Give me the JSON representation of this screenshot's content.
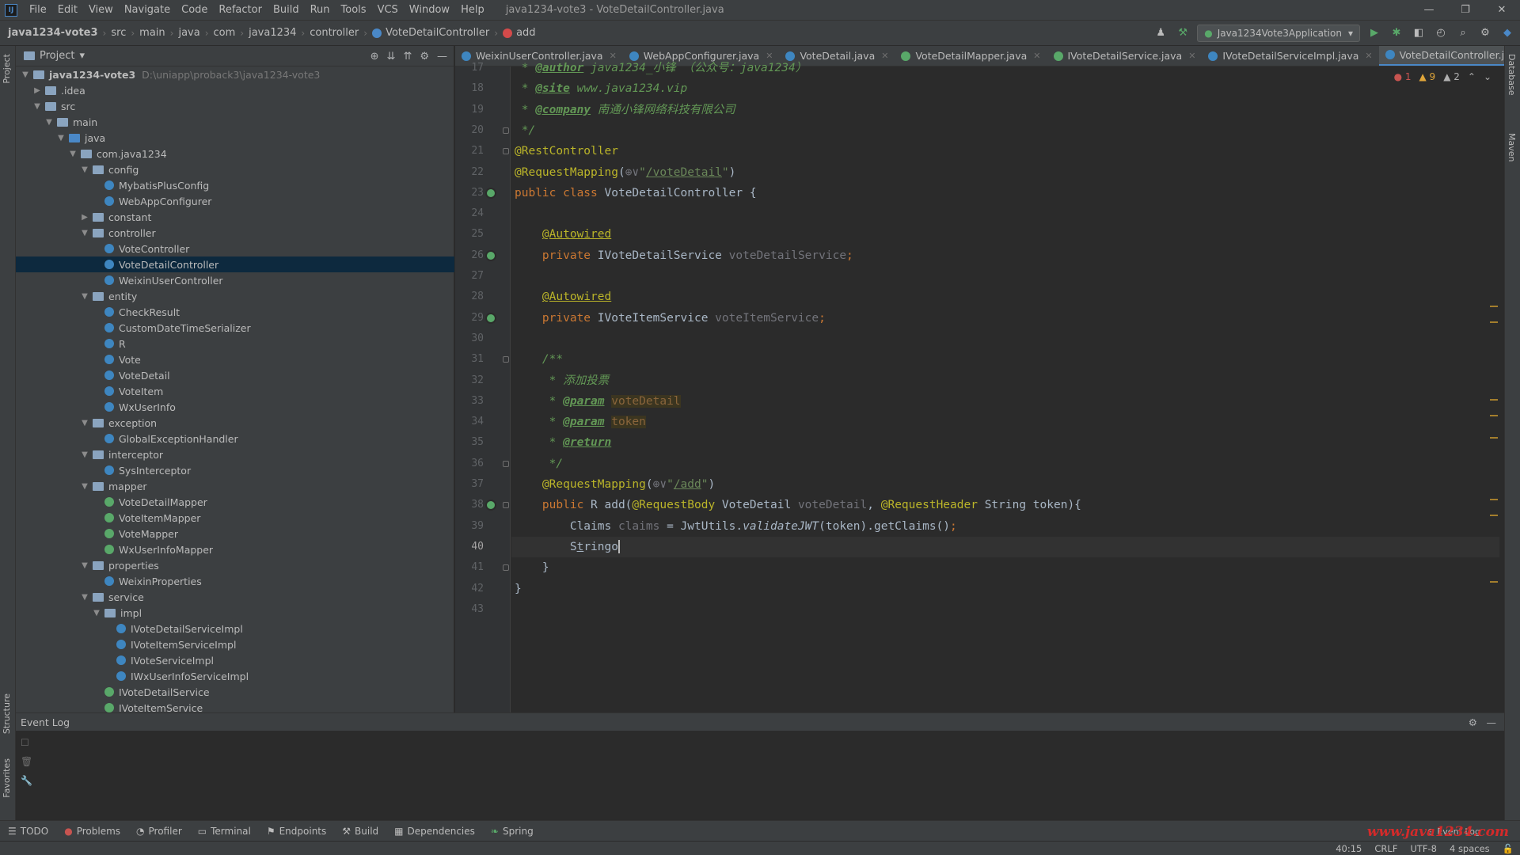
{
  "menubar": {
    "items": [
      "File",
      "Edit",
      "View",
      "Navigate",
      "Code",
      "Refactor",
      "Build",
      "Run",
      "Tools",
      "VCS",
      "Window",
      "Help"
    ],
    "window_title": "java1234-vote3 - VoteDetailController.java"
  },
  "navbar": {
    "breadcrumbs": [
      "java1234-vote3",
      "src",
      "main",
      "java",
      "com",
      "java1234",
      "controller",
      "VoteDetailController",
      "add"
    ],
    "run_config": "Java1234Vote3Application"
  },
  "project_panel": {
    "title": "Project",
    "root_name": "java1234-vote3",
    "root_path": "D:\\uniapp\\proback3\\java1234-vote3",
    "tree": [
      {
        "label": "java1234-vote3",
        "kind": "root"
      },
      {
        "label": ".idea",
        "kind": "folder",
        "level": 1,
        "open": false
      },
      {
        "label": "src",
        "kind": "folder",
        "level": 1,
        "open": true
      },
      {
        "label": "main",
        "kind": "folder",
        "level": 2,
        "open": true
      },
      {
        "label": "java",
        "kind": "srcfolder",
        "level": 3,
        "open": true
      },
      {
        "label": "com.java1234",
        "kind": "folder",
        "level": 4,
        "open": true
      },
      {
        "label": "config",
        "kind": "folder",
        "level": 5,
        "open": true
      },
      {
        "label": "MybatisPlusConfig",
        "kind": "class",
        "level": 6
      },
      {
        "label": "WebAppConfigurer",
        "kind": "class",
        "level": 6
      },
      {
        "label": "constant",
        "kind": "folder",
        "level": 5,
        "open": false
      },
      {
        "label": "controller",
        "kind": "folder",
        "level": 5,
        "open": true
      },
      {
        "label": "VoteController",
        "kind": "class",
        "level": 6
      },
      {
        "label": "VoteDetailController",
        "kind": "class",
        "level": 6,
        "selected": true
      },
      {
        "label": "WeixinUserController",
        "kind": "class",
        "level": 6
      },
      {
        "label": "entity",
        "kind": "folder",
        "level": 5,
        "open": true
      },
      {
        "label": "CheckResult",
        "kind": "class",
        "level": 6
      },
      {
        "label": "CustomDateTimeSerializer",
        "kind": "class",
        "level": 6
      },
      {
        "label": "R",
        "kind": "class",
        "level": 6
      },
      {
        "label": "Vote",
        "kind": "class",
        "level": 6
      },
      {
        "label": "VoteDetail",
        "kind": "class",
        "level": 6
      },
      {
        "label": "VoteItem",
        "kind": "class",
        "level": 6
      },
      {
        "label": "WxUserInfo",
        "kind": "class",
        "level": 6
      },
      {
        "label": "exception",
        "kind": "folder",
        "level": 5,
        "open": true
      },
      {
        "label": "GlobalExceptionHandler",
        "kind": "class",
        "level": 6
      },
      {
        "label": "interceptor",
        "kind": "folder",
        "level": 5,
        "open": true
      },
      {
        "label": "SysInterceptor",
        "kind": "class",
        "level": 6
      },
      {
        "label": "mapper",
        "kind": "folder",
        "level": 5,
        "open": true
      },
      {
        "label": "VoteDetailMapper",
        "kind": "interface",
        "level": 6
      },
      {
        "label": "VoteItemMapper",
        "kind": "interface",
        "level": 6
      },
      {
        "label": "VoteMapper",
        "kind": "interface",
        "level": 6
      },
      {
        "label": "WxUserInfoMapper",
        "kind": "interface",
        "level": 6
      },
      {
        "label": "properties",
        "kind": "folder",
        "level": 5,
        "open": true
      },
      {
        "label": "WeixinProperties",
        "kind": "class",
        "level": 6
      },
      {
        "label": "service",
        "kind": "folder",
        "level": 5,
        "open": true
      },
      {
        "label": "impl",
        "kind": "folder",
        "level": 6,
        "open": true
      },
      {
        "label": "IVoteDetailServiceImpl",
        "kind": "class",
        "level": 7
      },
      {
        "label": "IVoteItemServiceImpl",
        "kind": "class",
        "level": 7
      },
      {
        "label": "IVoteServiceImpl",
        "kind": "class",
        "level": 7
      },
      {
        "label": "IWxUserInfoServiceImpl",
        "kind": "class",
        "level": 7
      },
      {
        "label": "IVoteDetailService",
        "kind": "interface",
        "level": 6
      },
      {
        "label": "IVoteItemService",
        "kind": "interface",
        "level": 6
      }
    ]
  },
  "editor_tabs": [
    {
      "label": "WeixinUserController.java",
      "active": false
    },
    {
      "label": "WebAppConfigurer.java",
      "active": false
    },
    {
      "label": "VoteDetail.java",
      "active": false
    },
    {
      "label": "VoteDetailMapper.java",
      "active": false
    },
    {
      "label": "IVoteDetailService.java",
      "active": false
    },
    {
      "label": "IVoteDetailServiceImpl.java",
      "active": false
    },
    {
      "label": "VoteDetailController.java",
      "active": true
    }
  ],
  "inspections": {
    "errors": "1",
    "warnings": "9",
    "weak": "2"
  },
  "editor": {
    "lines": [
      {
        "n": "17",
        "html": "<span class=\"docc\"> * </span><span class=\"doctag\">@author</span><span class=\"docc\"> java1234_小锋 （公众号：java1234）</span>"
      },
      {
        "n": "18",
        "html": "<span class=\"docc\"> * </span><span class=\"doctag\">@site</span><span class=\"docc\"> www.java1234.vip</span>"
      },
      {
        "n": "19",
        "html": "<span class=\"docc\"> * </span><span class=\"doctag\">@company</span><span class=\"docc\"> 南通小锋网络科技有限公司</span>"
      },
      {
        "n": "20",
        "html": "<span class=\"docc\"> */</span>"
      },
      {
        "n": "21",
        "html": "<span class=\"ann\">@RestController</span>"
      },
      {
        "n": "22",
        "html": "<span class=\"ann\">@RequestMapping</span>(<span class=\"unused\">⊕∨</span><span class=\"str\">\"</span><span class=\"link\">/voteDetail</span><span class=\"str\">\"</span>)"
      },
      {
        "n": "23",
        "html": "<span class=\"kw\">public class </span>VoteDetailController {"
      },
      {
        "n": "24",
        "html": ""
      },
      {
        "n": "25",
        "html": "    <span class=\"ann\" style=\"text-decoration:underline\">@Autowired</span>"
      },
      {
        "n": "26",
        "html": "    <span class=\"kw\">private </span>IVoteDetailService <span class=\"unused\">voteDetailService</span><span class=\"kw\">;</span>"
      },
      {
        "n": "27",
        "html": ""
      },
      {
        "n": "28",
        "html": "    <span class=\"ann\" style=\"text-decoration:underline\">@Autowired</span>"
      },
      {
        "n": "29",
        "html": "    <span class=\"kw\">private </span>IVoteItemService <span class=\"unused\">voteItemService</span><span class=\"kw\">;</span>"
      },
      {
        "n": "30",
        "html": ""
      },
      {
        "n": "31",
        "html": "    <span class=\"docc\">/**</span>"
      },
      {
        "n": "32",
        "html": "<span class=\"docc\">     * 添加投票</span>"
      },
      {
        "n": "33",
        "html": "<span class=\"docc\">     * </span><span class=\"doctag\">@param</span><span class=\"docc\"> </span><span class=\"docval\">voteDetail</span>"
      },
      {
        "n": "34",
        "html": "<span class=\"docc\">     * </span><span class=\"doctag\">@param</span><span class=\"docc\"> </span><span class=\"docval\">token</span>"
      },
      {
        "n": "35",
        "html": "<span class=\"docc\">     * </span><span class=\"doctag\">@return</span>"
      },
      {
        "n": "36",
        "html": "<span class=\"docc\">     */</span>"
      },
      {
        "n": "37",
        "html": "    <span class=\"ann\">@RequestMapping</span>(<span class=\"unused\">⊕∨</span><span class=\"str\">\"</span><span class=\"link\">/add</span><span class=\"str\">\"</span>)"
      },
      {
        "n": "38",
        "html": "    <span class=\"kw\">public </span>R add(<span class=\"ann\">@RequestBody </span>VoteDetail <span class=\"unused\">voteDetail</span>, <span class=\"ann\">@RequestHeader </span>String token){"
      },
      {
        "n": "39",
        "html": "        Claims <span class=\"unused\">claims</span> = JwtUtils.<span class=\"ital\">validateJWT</span>(token).getClaims()<span class=\"kw\">;</span>"
      },
      {
        "n": "40",
        "html": "        S<span style=\"text-decoration:underline\">t</span>ringo<span class=\"caret\"></span>",
        "current": true
      },
      {
        "n": "41",
        "html": "    }"
      },
      {
        "n": "42",
        "html": "}"
      },
      {
        "n": "43",
        "html": ""
      }
    ]
  },
  "event_log": {
    "title": "Event Log"
  },
  "toolwindows": [
    "TODO",
    "Problems",
    "Profiler",
    "Terminal",
    "Endpoints",
    "Build",
    "Dependencies",
    "Spring"
  ],
  "status": {
    "position": "40:15",
    "line_sep": "CRLF",
    "encoding": "UTF-8",
    "indent": "4 spaces",
    "event_log_btn": "Event Log"
  },
  "watermark": "www.java1234.com",
  "sidebars": {
    "left": [
      "Project",
      "Structure",
      "Favorites"
    ],
    "right": [
      "Database",
      "Maven"
    ]
  }
}
